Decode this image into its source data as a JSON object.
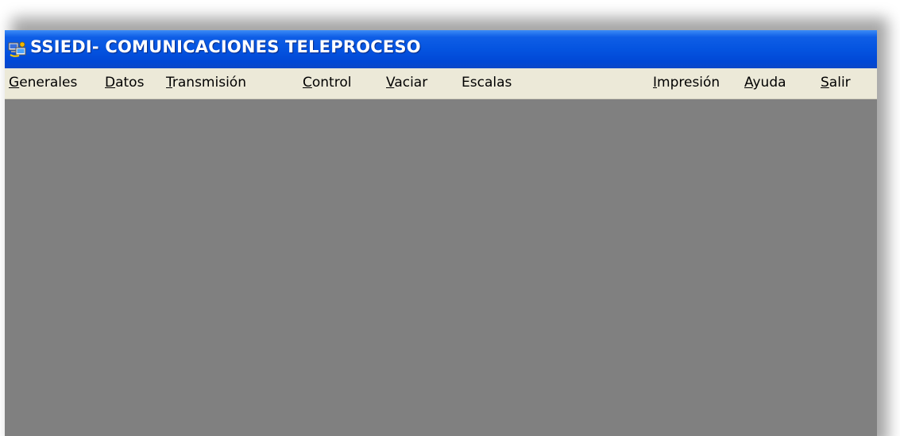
{
  "window": {
    "title": "SSIEDI- COMUNICACIONES TELEPROCESO",
    "icon": "app-icon"
  },
  "menu": [
    {
      "first": "G",
      "rest": "enerales"
    },
    {
      "first": "D",
      "rest": "atos"
    },
    {
      "first": "T",
      "rest": "ransmisión"
    },
    {
      "first": "C",
      "rest": "ontrol"
    },
    {
      "first": "V",
      "rest": "aciar"
    },
    {
      "first": "E",
      "rest": "scalas"
    },
    {
      "first": "I",
      "rest": "mpresión"
    },
    {
      "first": "A",
      "rest": "yuda"
    },
    {
      "first": "S",
      "rest": "alir"
    }
  ],
  "colors": {
    "titlebar": "#0554e0",
    "menubar": "#ece9d8",
    "client": "#808080"
  }
}
